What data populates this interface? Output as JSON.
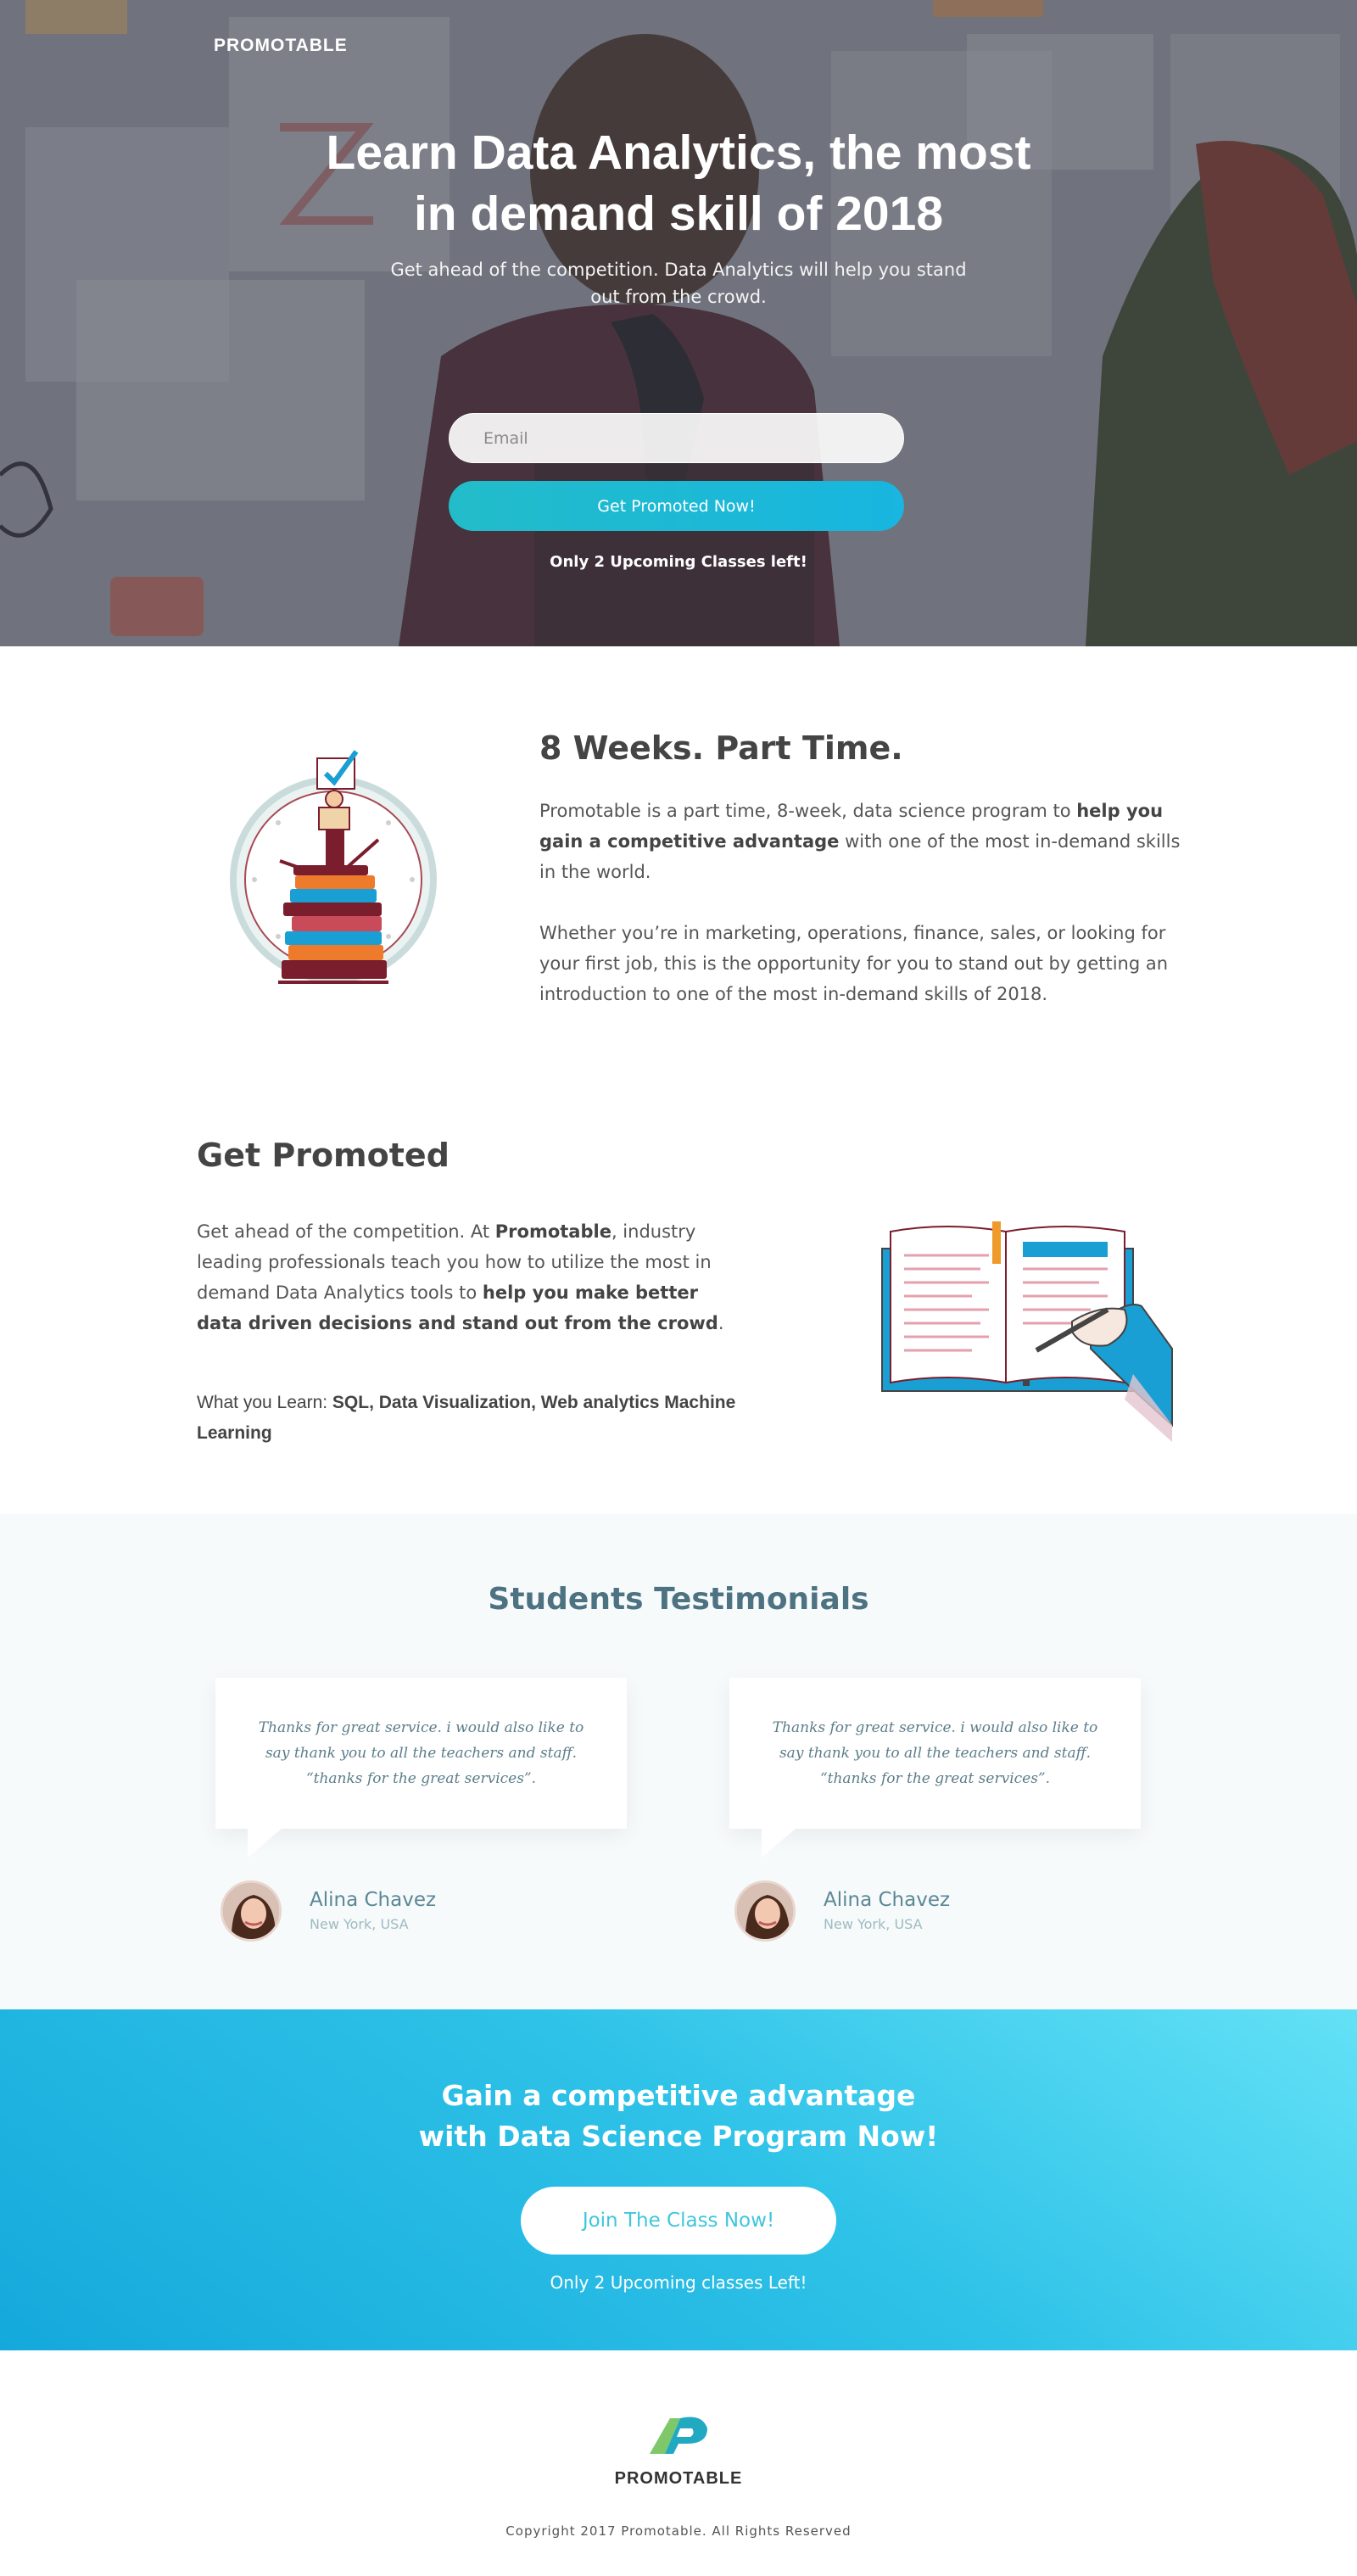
{
  "brand": "PROMOTABLE",
  "hero": {
    "title_line1": "Learn Data Analytics, the most",
    "title_line2": "in demand skill of 2018",
    "subtitle_line1": "Get ahead of the competition. Data Analytics will help you stand",
    "subtitle_line2": "out from the crowd.",
    "email_placeholder": "Email",
    "cta_label": "Get Promoted Now!",
    "note": "Only 2 Upcoming Classes left!"
  },
  "weeks": {
    "title": "8 Weeks. Part Time.",
    "p1_pre": "Promotable is a part time, 8-week, data science program to ",
    "p1_bold": "help you gain a competitive advantage",
    "p1_post": " with one of the most in-demand skills in the world.",
    "p2": "Whether you’re in marketing, operations, finance, sales, or looking for your first job, this is the opportunity for you to stand out by getting an introduction to one of the most in-demand skills of 2018."
  },
  "promoted": {
    "title": "Get Promoted",
    "p_pre": "Get ahead of the competition. At ",
    "p_brand": "Promotable",
    "p_mid": ", industry leading professionals teach you how to utilize the most in demand Data Analytics tools to ",
    "p_bold": "help you make better data driven decisions and stand out from the crowd",
    "p_end": ".",
    "learn_label": "What you Learn: ",
    "learn_items": "SQL, Data Visualization, Web analytics Machine Learning"
  },
  "testimonials": {
    "title": "Students Testimonials",
    "items": [
      {
        "quote": "Thanks for great service. i would also like to say thank you to all the teachers and staff. “thanks for the great services”.",
        "name": "Alina Chavez",
        "location": "New York, USA"
      },
      {
        "quote": "Thanks for great service. i would also like to say thank you to all the teachers and staff. “thanks for the great services”.",
        "name": "Alina Chavez",
        "location": "New York, USA"
      }
    ]
  },
  "cta": {
    "title_line1": "Gain a competitive advantage",
    "title_line2": "with Data Science Program Now!",
    "button": "Join The Class Now!",
    "note": "Only 2 Upcoming classes Left!"
  },
  "footer": {
    "name": "PROMOTABLE",
    "copyright": "Copyright 2017 Promotable. All Rights Reserved"
  },
  "colors": {
    "accent": "#18b6e0",
    "teal": "#22bcc9",
    "text": "#444444",
    "testimonial_bg": "#f6fafb"
  }
}
